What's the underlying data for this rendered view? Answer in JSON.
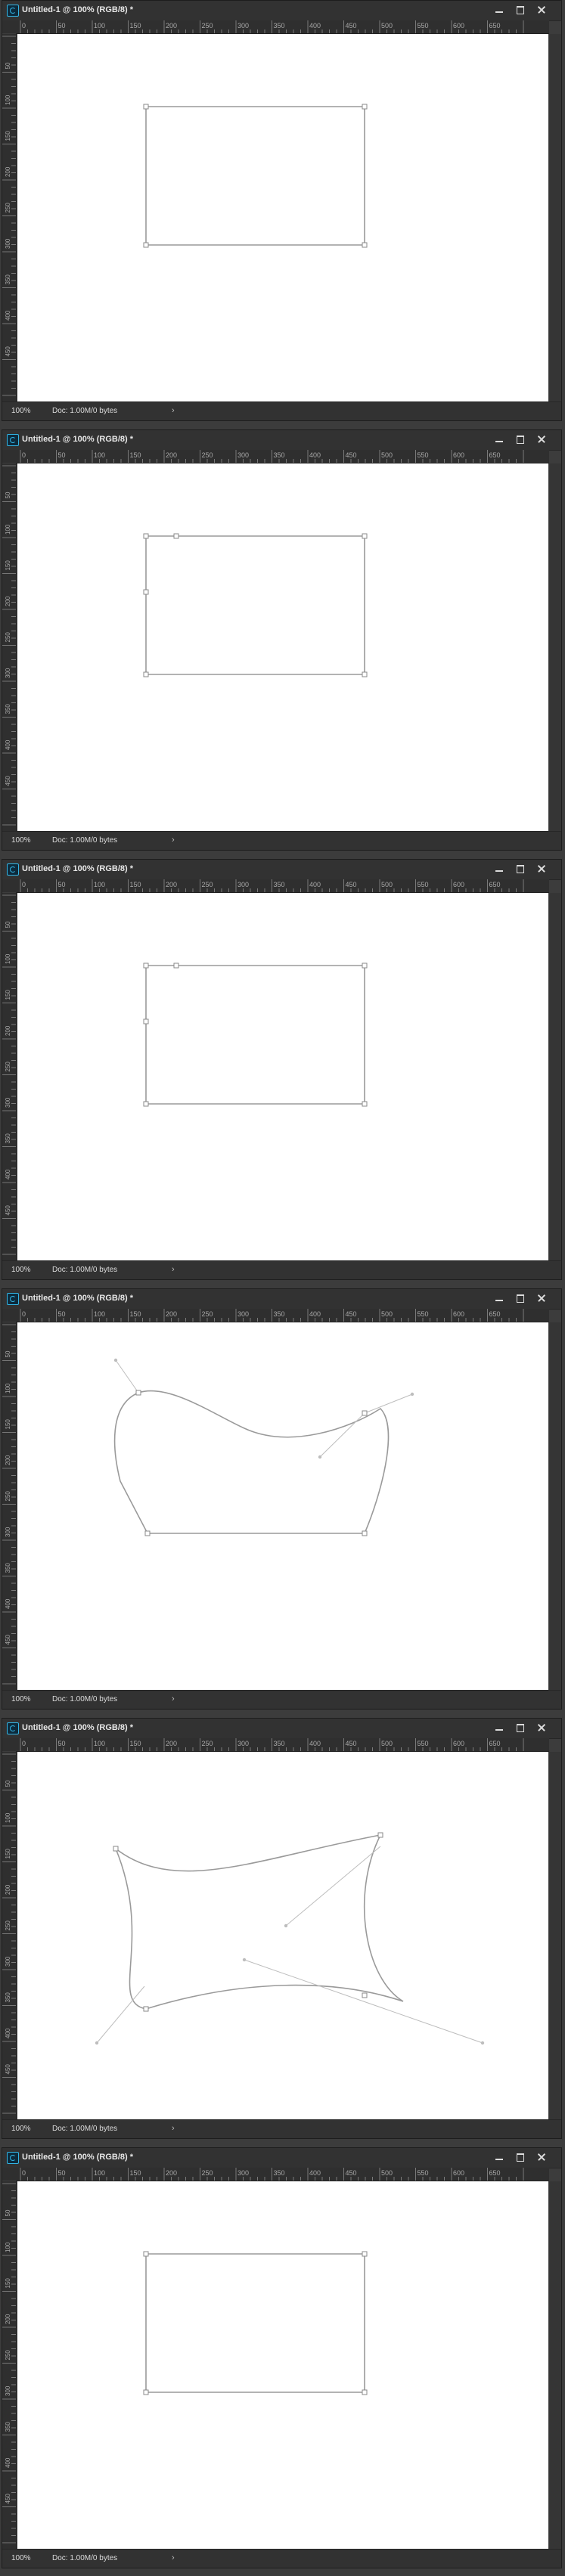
{
  "windows": [
    {
      "title": "Untitled-1 @ 100% (RGB/8) *",
      "zoom": "100%",
      "doc": "Doc: 1.00M/0 bytes",
      "shape": "rect"
    },
    {
      "title": "Untitled-1 @ 100% (RGB/8) *",
      "zoom": "100%",
      "doc": "Doc: 1.00M/0 bytes",
      "shape": "rect-anchor"
    },
    {
      "title": "Untitled-1 @ 100% (RGB/8) *",
      "zoom": "100%",
      "doc": "Doc: 1.00M/0 bytes",
      "shape": "rect-anchor"
    },
    {
      "title": "Untitled-1 @ 100% (RGB/8) *",
      "zoom": "100%",
      "doc": "Doc: 1.00M/0 bytes",
      "shape": "curve1"
    },
    {
      "title": "Untitled-1 @ 100% (RGB/8) *",
      "zoom": "100%",
      "doc": "Doc: 1.00M/0 bytes",
      "shape": "curve2"
    },
    {
      "title": "Untitled-1 @ 100% (RGB/8) *",
      "zoom": "100%",
      "doc": "Doc: 1.00M/0 bytes",
      "shape": "rect"
    }
  ],
  "hruler_labels": [
    "0",
    "50",
    "100",
    "150",
    "200",
    "250",
    "300",
    "350",
    "400",
    "450",
    "500",
    "550",
    "600",
    "650"
  ],
  "vruler_labels": [
    "50",
    "100",
    "150",
    "200",
    "250",
    "300",
    "350",
    "400",
    "450"
  ],
  "icons": {
    "minimize": "minimize-icon",
    "maximize": "maximize-icon",
    "close": "close-icon",
    "app": "photoshop-icon",
    "status_menu": "chevron-right-icon"
  },
  "colors": {
    "path": "#9a9a9a",
    "handle": "#bdbdbd",
    "chrome": "#323232",
    "canvas": "#ffffff"
  }
}
